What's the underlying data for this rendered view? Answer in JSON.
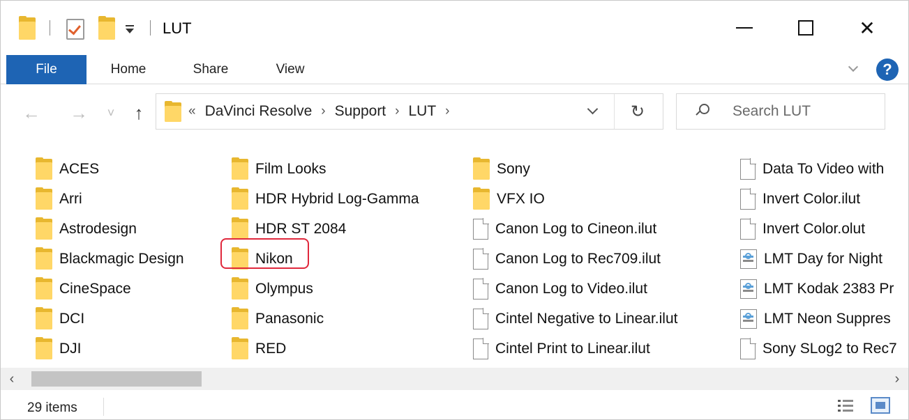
{
  "window": {
    "title": "LUT",
    "controls": {
      "minimize": "—",
      "maximize": "☐",
      "close": "✕"
    }
  },
  "ribbon": {
    "tabs": [
      {
        "label": "File",
        "active": true
      },
      {
        "label": "Home"
      },
      {
        "label": "Share"
      },
      {
        "label": "View"
      }
    ],
    "help_label": "?"
  },
  "navigation": {
    "back": "←",
    "forward": "→",
    "recent": "˅",
    "up": "↑",
    "breadcrumb": {
      "overflow": "«",
      "parts": [
        "DaVinci Resolve",
        "Support",
        "LUT"
      ],
      "separator": "›"
    },
    "refresh": "↻"
  },
  "search": {
    "placeholder": "Search LUT"
  },
  "columns": [
    {
      "items": [
        {
          "name": "ACES",
          "type": "folder"
        },
        {
          "name": "Arri",
          "type": "folder"
        },
        {
          "name": "Astrodesign",
          "type": "folder"
        },
        {
          "name": "Blackmagic Design",
          "type": "folder"
        },
        {
          "name": "CineSpace",
          "type": "folder"
        },
        {
          "name": "DCI",
          "type": "folder"
        },
        {
          "name": "DJI",
          "type": "folder"
        }
      ]
    },
    {
      "items": [
        {
          "name": "Film Looks",
          "type": "folder"
        },
        {
          "name": "HDR Hybrid Log-Gamma",
          "type": "folder"
        },
        {
          "name": "HDR ST 2084",
          "type": "folder"
        },
        {
          "name": "Nikon",
          "type": "folder",
          "highlighted": true
        },
        {
          "name": "Olympus",
          "type": "folder"
        },
        {
          "name": "Panasonic",
          "type": "folder"
        },
        {
          "name": "RED",
          "type": "folder"
        }
      ]
    },
    {
      "items": [
        {
          "name": "Sony",
          "type": "folder"
        },
        {
          "name": "VFX IO",
          "type": "folder"
        },
        {
          "name": "Canon Log to Cineon.ilut",
          "type": "file"
        },
        {
          "name": "Canon Log to Rec709.ilut",
          "type": "file"
        },
        {
          "name": "Canon Log to Video.ilut",
          "type": "file"
        },
        {
          "name": "Cintel Negative to Linear.ilut",
          "type": "file"
        },
        {
          "name": "Cintel Print to Linear.ilut",
          "type": "file"
        }
      ]
    },
    {
      "items": [
        {
          "name": "Data To Video with",
          "type": "file"
        },
        {
          "name": "Invert Color.ilut",
          "type": "file"
        },
        {
          "name": "Invert Color.olut",
          "type": "file"
        },
        {
          "name": "LMT Day for Night",
          "type": "config"
        },
        {
          "name": "LMT Kodak 2383 Pr",
          "type": "config"
        },
        {
          "name": "LMT Neon Suppres",
          "type": "config"
        },
        {
          "name": "Sony SLog2 to Rec7",
          "type": "file"
        }
      ]
    }
  ],
  "scrollbar": {
    "left": "‹",
    "right": "›"
  },
  "status": {
    "item_count": "29 items"
  },
  "colors": {
    "accent": "#1e64b4",
    "folder": "#ffd767",
    "highlight": "#e0283c"
  }
}
